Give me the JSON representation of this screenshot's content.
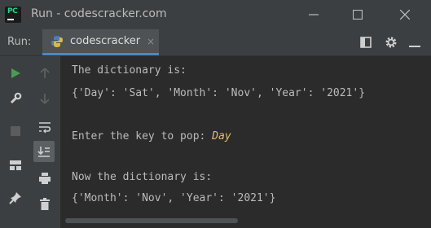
{
  "window": {
    "title": "Run - codescracker.com",
    "logo_text": "PC",
    "controls": [
      "minimize",
      "maximize",
      "close"
    ]
  },
  "toolbar": {
    "run_label": "Run:",
    "tab_label": "codescracker",
    "tab_close": "×",
    "icons": [
      "layout-icon",
      "gear-icon",
      "hide-icon"
    ]
  },
  "sidebar": {
    "icons": [
      "run-icon",
      "up-arrow-icon",
      "wrench-icon",
      "down-arrow-icon",
      "stop-icon",
      "soft-wrap-icon",
      "scroll-to-end-icon",
      "layout-icon",
      "print-icon",
      "pin-icon",
      "trash-icon"
    ]
  },
  "console": {
    "lines": [
      "The dictionary is:",
      "{'Day': 'Sat', 'Month': 'Nov', 'Year': '2021'}",
      "",
      "Enter the key to pop: ",
      "",
      "Now the dictionary is:",
      "{'Month': 'Nov', 'Year': '2021'}"
    ],
    "user_input": "Day"
  },
  "colors": {
    "background": "#2b2b2b",
    "chrome": "#3c3f41",
    "text": "#bbbbbb",
    "input": "#e8bf6a",
    "tab_underline": "#4a88c7",
    "run_green": "#499c54"
  }
}
